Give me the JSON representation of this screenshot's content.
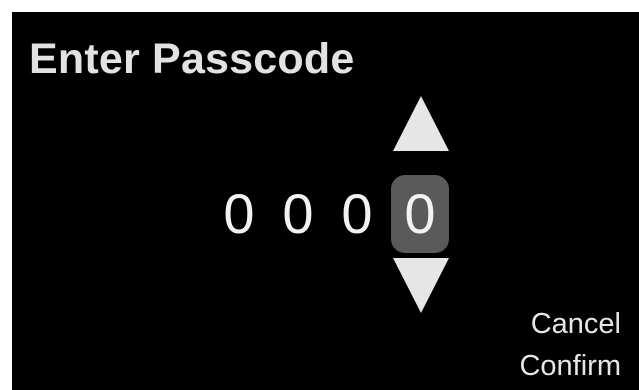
{
  "dialog": {
    "title": "Enter Passcode",
    "digits": [
      "0",
      "0",
      "0",
      "0"
    ],
    "selected_digit_index": 3,
    "cancel_label": "Cancel",
    "confirm_label": "Confirm"
  },
  "colors": {
    "background": "#000000",
    "text": "#e8e8e8",
    "selected_highlight": "#5a5a5a"
  },
  "icons": {
    "increment": "triangle-up-icon",
    "decrement": "triangle-down-icon"
  }
}
